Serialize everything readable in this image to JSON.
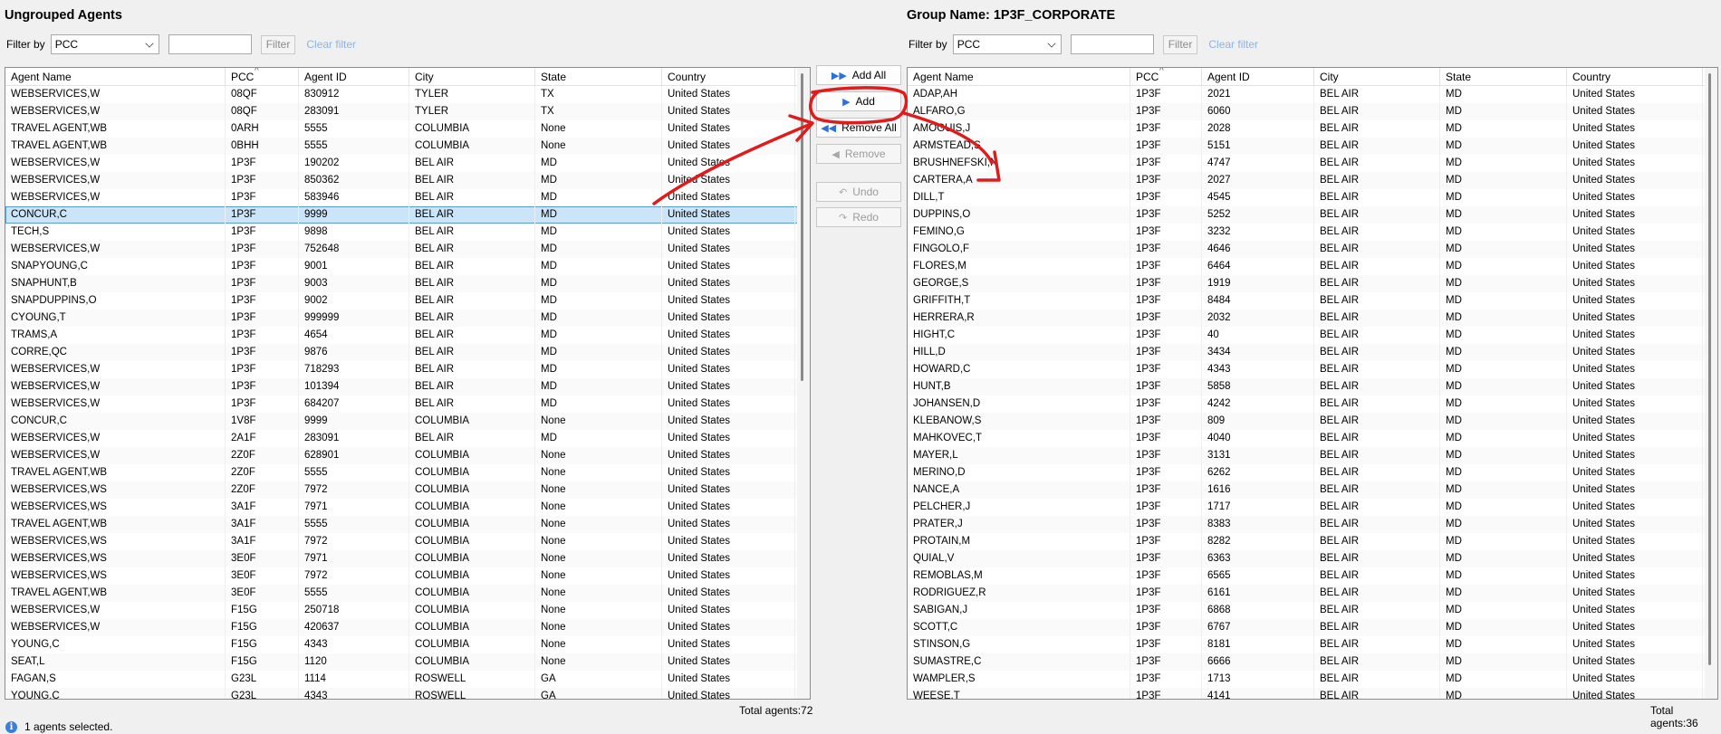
{
  "left": {
    "title": "Ungrouped Agents",
    "filter_label": "Filter by",
    "filter_field": "PCC",
    "filter_value": "",
    "filter_button": "Filter",
    "clear_filter": "Clear filter",
    "columns": [
      "Agent Name",
      "PCC",
      "Agent ID",
      "City",
      "State",
      "Country"
    ],
    "rows": [
      [
        "WEBSERVICES,W",
        "08QF",
        "830912",
        "TYLER",
        "TX",
        "United States"
      ],
      [
        "WEBSERVICES,W",
        "08QF",
        "283091",
        "TYLER",
        "TX",
        "United States"
      ],
      [
        "TRAVEL AGENT,WB",
        "0ARH",
        "5555",
        "COLUMBIA",
        "None",
        "United States"
      ],
      [
        "TRAVEL AGENT,WB",
        "0BHH",
        "5555",
        "COLUMBIA",
        "None",
        "United States"
      ],
      [
        "WEBSERVICES,W",
        "1P3F",
        "190202",
        "BEL AIR",
        "MD",
        "United States"
      ],
      [
        "WEBSERVICES,W",
        "1P3F",
        "850362",
        "BEL AIR",
        "MD",
        "United States"
      ],
      [
        "WEBSERVICES,W",
        "1P3F",
        "583946",
        "BEL AIR",
        "MD",
        "United States"
      ],
      [
        "CONCUR,C",
        "1P3F",
        "9999",
        "BEL AIR",
        "MD",
        "United States"
      ],
      [
        "TECH,S",
        "1P3F",
        "9898",
        "BEL AIR",
        "MD",
        "United States"
      ],
      [
        "WEBSERVICES,W",
        "1P3F",
        "752648",
        "BEL AIR",
        "MD",
        "United States"
      ],
      [
        "SNAPYOUNG,C",
        "1P3F",
        "9001",
        "BEL AIR",
        "MD",
        "United States"
      ],
      [
        "SNAPHUNT,B",
        "1P3F",
        "9003",
        "BEL AIR",
        "MD",
        "United States"
      ],
      [
        "SNAPDUPPINS,O",
        "1P3F",
        "9002",
        "BEL AIR",
        "MD",
        "United States"
      ],
      [
        "CYOUNG,T",
        "1P3F",
        "999999",
        "BEL AIR",
        "MD",
        "United States"
      ],
      [
        "TRAMS,A",
        "1P3F",
        "4654",
        "BEL AIR",
        "MD",
        "United States"
      ],
      [
        "CORRE,QC",
        "1P3F",
        "9876",
        "BEL AIR",
        "MD",
        "United States"
      ],
      [
        "WEBSERVICES,W",
        "1P3F",
        "718293",
        "BEL AIR",
        "MD",
        "United States"
      ],
      [
        "WEBSERVICES,W",
        "1P3F",
        "101394",
        "BEL AIR",
        "MD",
        "United States"
      ],
      [
        "WEBSERVICES,W",
        "1P3F",
        "684207",
        "BEL AIR",
        "MD",
        "United States"
      ],
      [
        "CONCUR,C",
        "1V8F",
        "9999",
        "COLUMBIA",
        "None",
        "United States"
      ],
      [
        "WEBSERVICES,W",
        "2A1F",
        "283091",
        "BEL AIR",
        "MD",
        "United States"
      ],
      [
        "WEBSERVICES,W",
        "2Z0F",
        "628901",
        "COLUMBIA",
        "None",
        "United States"
      ],
      [
        "TRAVEL AGENT,WB",
        "2Z0F",
        "5555",
        "COLUMBIA",
        "None",
        "United States"
      ],
      [
        "WEBSERVICES,WS",
        "2Z0F",
        "7972",
        "COLUMBIA",
        "None",
        "United States"
      ],
      [
        "WEBSERVICES,WS",
        "3A1F",
        "7971",
        "COLUMBIA",
        "None",
        "United States"
      ],
      [
        "TRAVEL AGENT,WB",
        "3A1F",
        "5555",
        "COLUMBIA",
        "None",
        "United States"
      ],
      [
        "WEBSERVICES,WS",
        "3A1F",
        "7972",
        "COLUMBIA",
        "None",
        "United States"
      ],
      [
        "WEBSERVICES,WS",
        "3E0F",
        "7971",
        "COLUMBIA",
        "None",
        "United States"
      ],
      [
        "WEBSERVICES,WS",
        "3E0F",
        "7972",
        "COLUMBIA",
        "None",
        "United States"
      ],
      [
        "TRAVEL AGENT,WB",
        "3E0F",
        "5555",
        "COLUMBIA",
        "None",
        "United States"
      ],
      [
        "WEBSERVICES,W",
        "F15G",
        "250718",
        "COLUMBIA",
        "None",
        "United States"
      ],
      [
        "WEBSERVICES,W",
        "F15G",
        "420637",
        "COLUMBIA",
        "None",
        "United States"
      ],
      [
        "YOUNG,C",
        "F15G",
        "4343",
        "COLUMBIA",
        "None",
        "United States"
      ],
      [
        "SEAT,L",
        "F15G",
        "1120",
        "COLUMBIA",
        "None",
        "United States"
      ],
      [
        "FAGAN,S",
        "G23L",
        "1114",
        "ROSWELL",
        "GA",
        "United States"
      ],
      [
        "YOUNG,C",
        "G23L",
        "4343",
        "ROSWELL",
        "GA",
        "United States"
      ]
    ],
    "selected_row": 7,
    "total": "Total agents:72"
  },
  "right": {
    "title": "Group Name: 1P3F_CORPORATE",
    "filter_label": "Filter by",
    "filter_field": "PCC",
    "filter_value": "",
    "filter_button": "Filter",
    "clear_filter": "Clear filter",
    "columns": [
      "Agent Name",
      "PCC",
      "Agent ID",
      "City",
      "State",
      "Country"
    ],
    "rows": [
      [
        "ADAP,AH",
        "1P3F",
        "2021",
        "BEL AIR",
        "MD",
        "United States"
      ],
      [
        "ALFARO,G",
        "1P3F",
        "6060",
        "BEL AIR",
        "MD",
        "United States"
      ],
      [
        "AMOGUIS,J",
        "1P3F",
        "2028",
        "BEL AIR",
        "MD",
        "United States"
      ],
      [
        "ARMSTEAD,S",
        "1P3F",
        "5151",
        "BEL AIR",
        "MD",
        "United States"
      ],
      [
        "BRUSHNEFSKI,N",
        "1P3F",
        "4747",
        "BEL AIR",
        "MD",
        "United States"
      ],
      [
        "CARTERA,A",
        "1P3F",
        "2027",
        "BEL AIR",
        "MD",
        "United States"
      ],
      [
        "DILL,T",
        "1P3F",
        "4545",
        "BEL AIR",
        "MD",
        "United States"
      ],
      [
        "DUPPINS,O",
        "1P3F",
        "5252",
        "BEL AIR",
        "MD",
        "United States"
      ],
      [
        "FEMINO,G",
        "1P3F",
        "3232",
        "BEL AIR",
        "MD",
        "United States"
      ],
      [
        "FINGOLO,F",
        "1P3F",
        "4646",
        "BEL AIR",
        "MD",
        "United States"
      ],
      [
        "FLORES,M",
        "1P3F",
        "6464",
        "BEL AIR",
        "MD",
        "United States"
      ],
      [
        "GEORGE,S",
        "1P3F",
        "1919",
        "BEL AIR",
        "MD",
        "United States"
      ],
      [
        "GRIFFITH,T",
        "1P3F",
        "8484",
        "BEL AIR",
        "MD",
        "United States"
      ],
      [
        "HERRERA,R",
        "1P3F",
        "2032",
        "BEL AIR",
        "MD",
        "United States"
      ],
      [
        "HIGHT,C",
        "1P3F",
        "40",
        "BEL AIR",
        "MD",
        "United States"
      ],
      [
        "HILL,D",
        "1P3F",
        "3434",
        "BEL AIR",
        "MD",
        "United States"
      ],
      [
        "HOWARD,C",
        "1P3F",
        "4343",
        "BEL AIR",
        "MD",
        "United States"
      ],
      [
        "HUNT,B",
        "1P3F",
        "5858",
        "BEL AIR",
        "MD",
        "United States"
      ],
      [
        "JOHANSEN,D",
        "1P3F",
        "4242",
        "BEL AIR",
        "MD",
        "United States"
      ],
      [
        "KLEBANOW,S",
        "1P3F",
        "809",
        "BEL AIR",
        "MD",
        "United States"
      ],
      [
        "MAHKOVEC,T",
        "1P3F",
        "4040",
        "BEL AIR",
        "MD",
        "United States"
      ],
      [
        "MAYER,L",
        "1P3F",
        "3131",
        "BEL AIR",
        "MD",
        "United States"
      ],
      [
        "MERINO,D",
        "1P3F",
        "6262",
        "BEL AIR",
        "MD",
        "United States"
      ],
      [
        "NANCE,A",
        "1P3F",
        "1616",
        "BEL AIR",
        "MD",
        "United States"
      ],
      [
        "PELCHER,J",
        "1P3F",
        "1717",
        "BEL AIR",
        "MD",
        "United States"
      ],
      [
        "PRATER,J",
        "1P3F",
        "8383",
        "BEL AIR",
        "MD",
        "United States"
      ],
      [
        "PROTAIN,M",
        "1P3F",
        "8282",
        "BEL AIR",
        "MD",
        "United States"
      ],
      [
        "QUIAL,V",
        "1P3F",
        "6363",
        "BEL AIR",
        "MD",
        "United States"
      ],
      [
        "REMOBLAS,M",
        "1P3F",
        "6565",
        "BEL AIR",
        "MD",
        "United States"
      ],
      [
        "RODRIGUEZ,R",
        "1P3F",
        "6161",
        "BEL AIR",
        "MD",
        "United States"
      ],
      [
        "SABIGAN,J",
        "1P3F",
        "6868",
        "BEL AIR",
        "MD",
        "United States"
      ],
      [
        "SCOTT,C",
        "1P3F",
        "6767",
        "BEL AIR",
        "MD",
        "United States"
      ],
      [
        "STINSON,G",
        "1P3F",
        "8181",
        "BEL AIR",
        "MD",
        "United States"
      ],
      [
        "SUMASTRE,C",
        "1P3F",
        "6666",
        "BEL AIR",
        "MD",
        "United States"
      ],
      [
        "WAMPLER,S",
        "1P3F",
        "1713",
        "BEL AIR",
        "MD",
        "United States"
      ],
      [
        "WEESE,T",
        "1P3F",
        "4141",
        "BEL AIR",
        "MD",
        "United States"
      ]
    ],
    "total": "Total agents:36"
  },
  "buttons": {
    "add_all": "Add All",
    "add": "Add",
    "remove_all": "Remove All",
    "remove": "Remove",
    "undo": "Undo",
    "redo": "Redo"
  },
  "status": "1 agents selected.",
  "colors": {
    "annotation": "#e01b1b",
    "selection": "#cce4f7",
    "accent": "#2f6fd8"
  }
}
